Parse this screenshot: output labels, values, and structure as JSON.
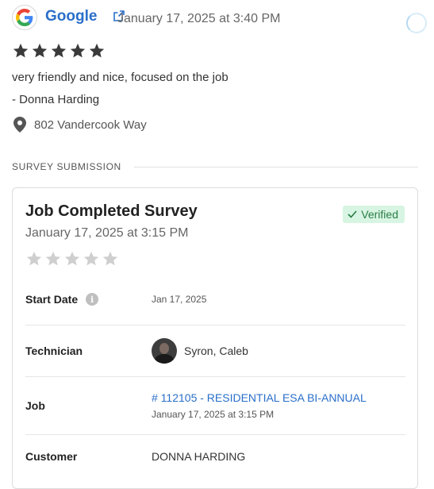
{
  "review": {
    "source_name": "Google",
    "date": "January 17, 2025 at 3:40 PM",
    "rating": 5,
    "text": "very friendly and nice, focused on the job",
    "reviewer": "- Donna Harding",
    "address": "802 Vandercook Way"
  },
  "section": {
    "label": "SURVEY SUBMISSION"
  },
  "survey": {
    "title": "Job Completed Survey",
    "date": "January 17, 2025 at 3:15 PM",
    "badge": "Verified",
    "rating": 0,
    "rows": {
      "start_date": {
        "label": "Start Date",
        "value": "Jan 17, 2025"
      },
      "technician": {
        "label": "Technician",
        "value": "Syron, Caleb"
      },
      "job": {
        "label": "Job",
        "link": "# 112105 - RESIDENTIAL ESA BI-ANNUAL",
        "date": "January 17, 2025 at 3:15 PM"
      },
      "customer": {
        "label": "Customer",
        "value": "DONNA HARDING"
      }
    }
  },
  "icons": {
    "info": "i"
  },
  "colors": {
    "brand_blue": "#2a6fc9",
    "verified_bg": "#d7f5e2",
    "verified_text": "#2a7c45",
    "star_filled": "#3a3a3a",
    "star_empty": "#cfcfcf"
  }
}
